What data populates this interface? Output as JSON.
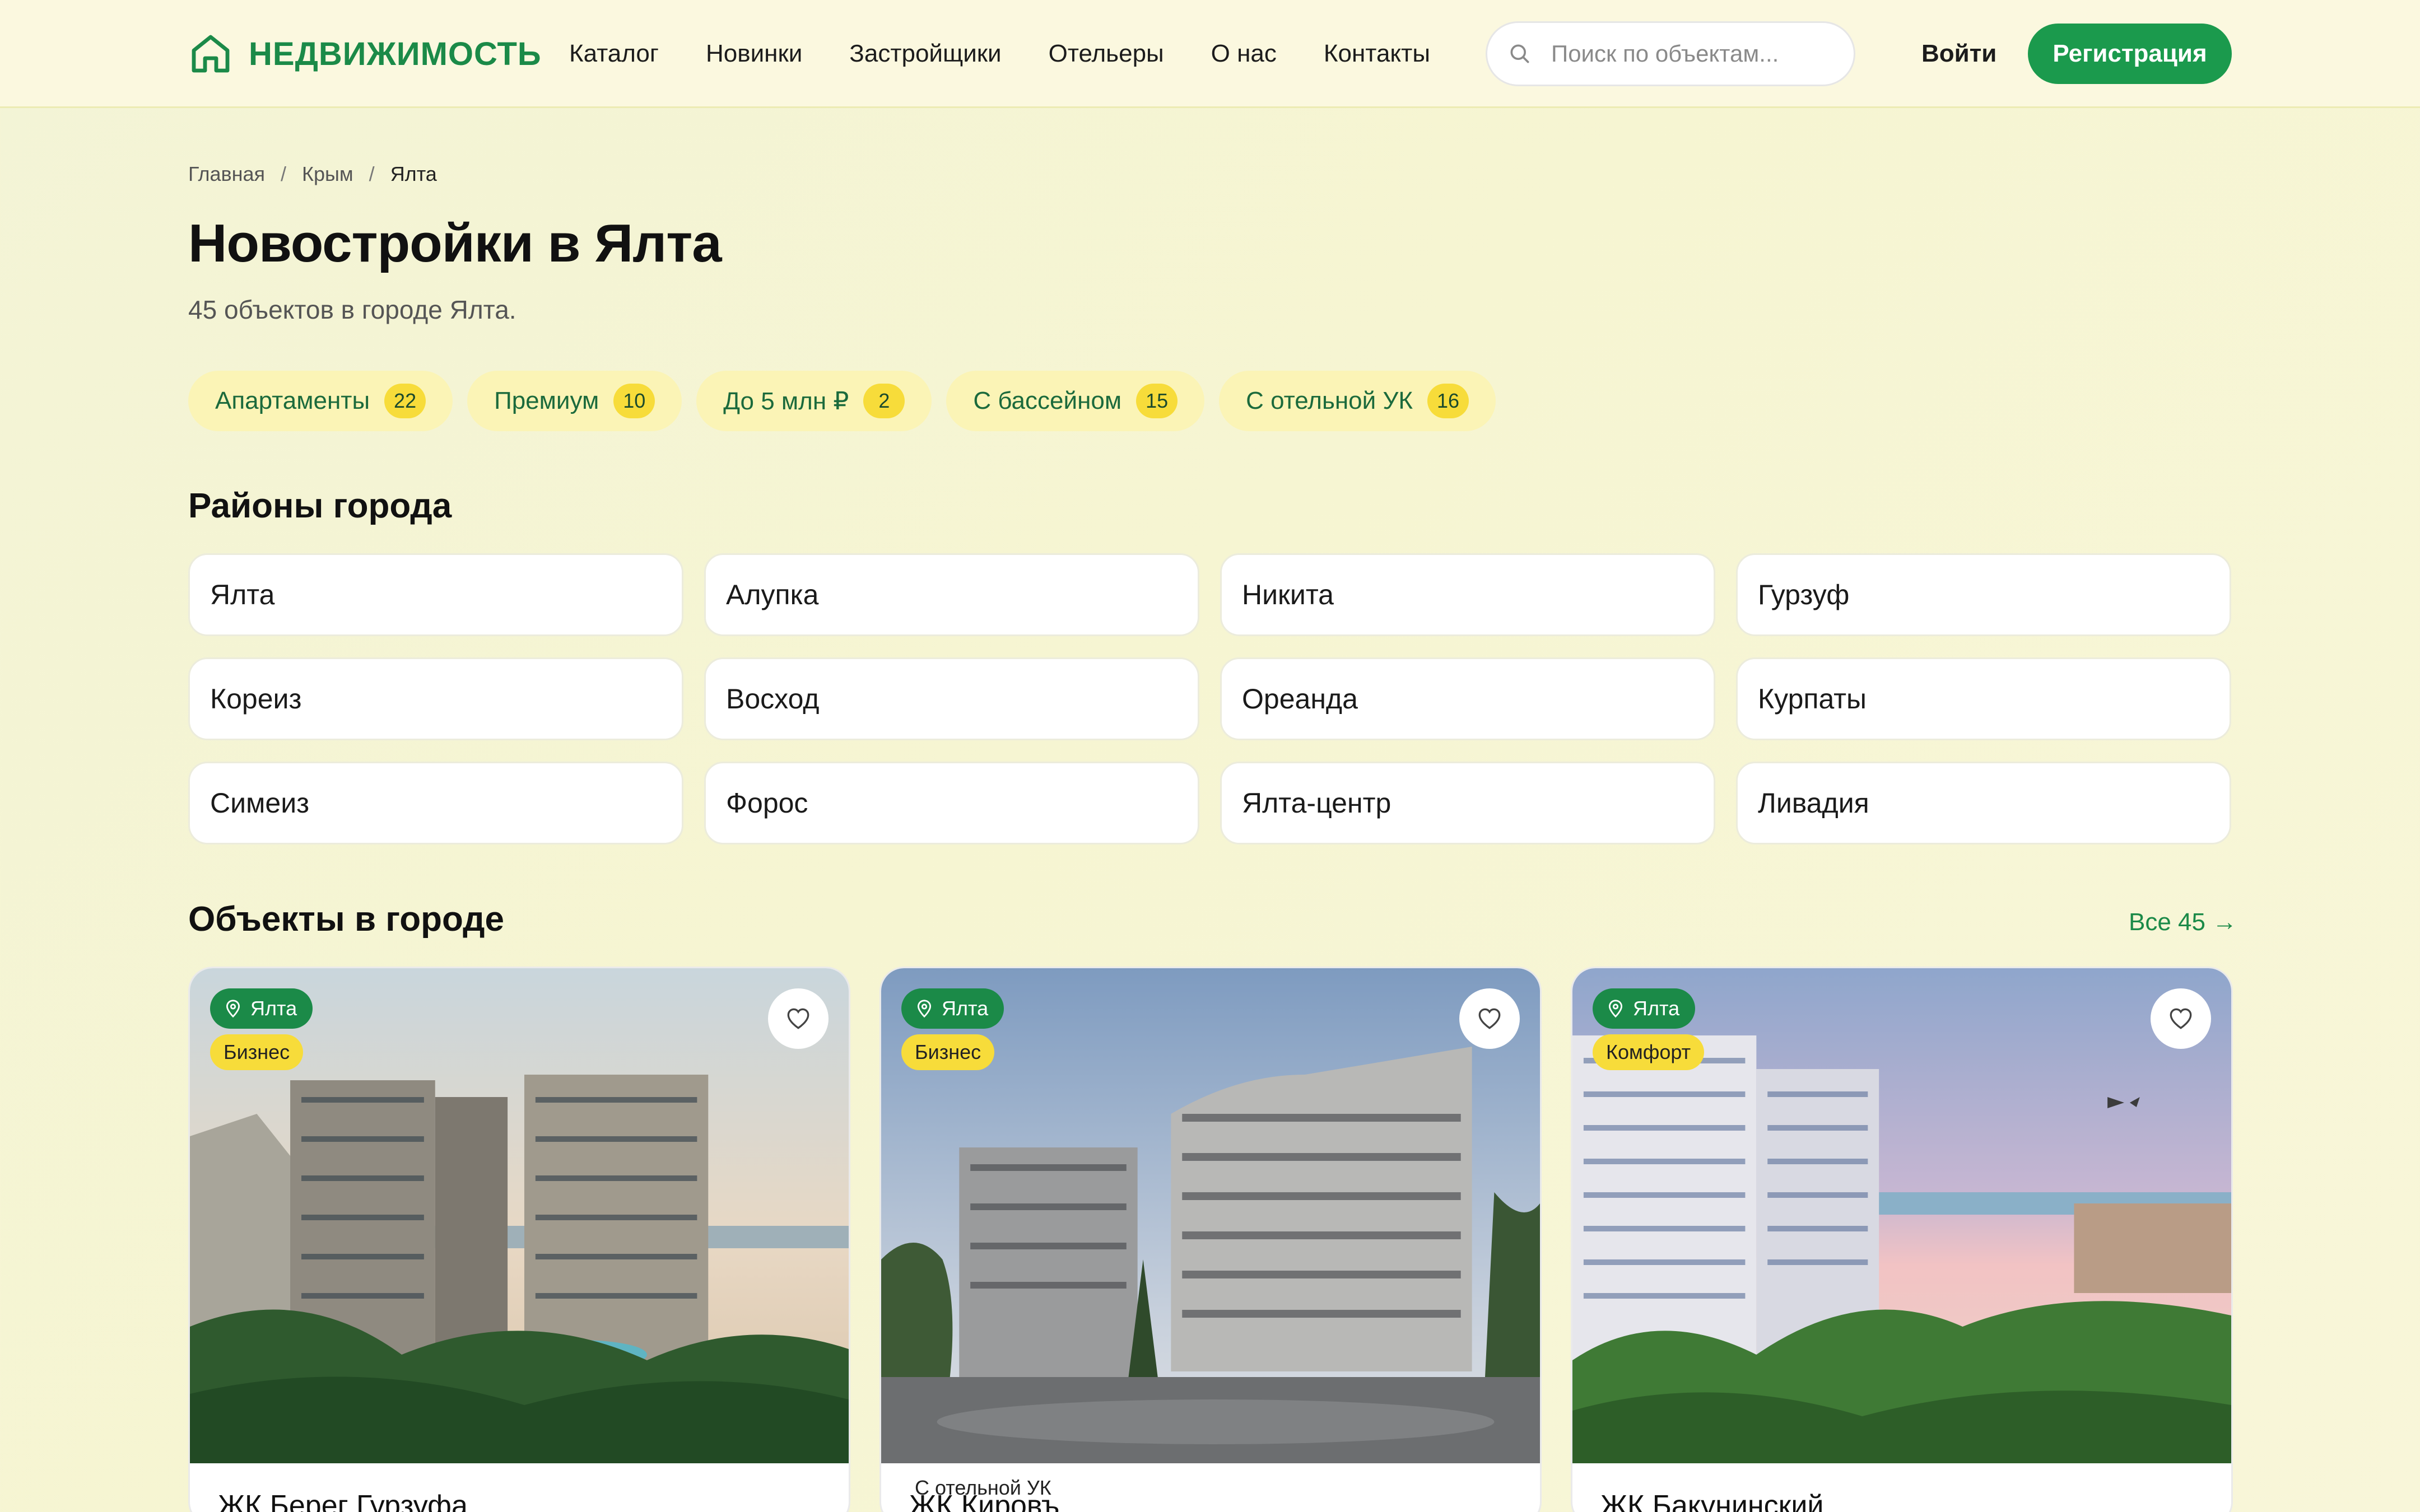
{
  "header": {
    "logo_text": "НЕДВИЖИМОСТЬ",
    "nav": [
      "Каталог",
      "Новинки",
      "Застройщики",
      "Отельеры",
      "О нас",
      "Контакты"
    ],
    "search_placeholder": "Поиск по объектам...",
    "login_label": "Войти",
    "register_label": "Регистрация"
  },
  "breadcrumb": [
    "Главная",
    "Крым",
    "Ялта"
  ],
  "page": {
    "title": "Новостройки в Ялта",
    "subtitle": "45 объектов в городе Ялта."
  },
  "filters": [
    {
      "label": "Апартаменты",
      "count": "22"
    },
    {
      "label": "Премиум",
      "count": "10"
    },
    {
      "label": "До 5 млн ₽",
      "count": "2"
    },
    {
      "label": "С бассейном",
      "count": "15"
    },
    {
      "label": "С отельной УК",
      "count": "16"
    }
  ],
  "districts": {
    "title": "Районы города",
    "items": [
      "Ялта",
      "Алупка",
      "Никита",
      "Гурзуф",
      "Кореиз",
      "Восход",
      "Ореанда",
      "Курпаты",
      "Симеиз",
      "Форос",
      "Ялта-центр",
      "Ливадия"
    ]
  },
  "objects": {
    "title": "Объекты в городе",
    "all_link": "Все 45 →",
    "cards": [
      {
        "city": "Ялта",
        "class": "Бизнес",
        "hotel_tag": "",
        "name": "ЖК Берег Гурзуфа",
        "scene": "sunset"
      },
      {
        "city": "Ялта",
        "class": "Бизнес",
        "hotel_tag": "С отельной УК",
        "name": "ЖК Кировъ",
        "scene": "grey"
      },
      {
        "city": "Ялта",
        "class": "Комфорт",
        "hotel_tag": "",
        "name": "ЖК Бакунинский",
        "scene": "sea"
      }
    ]
  },
  "colors": {
    "brand_green": "#1b9a4d",
    "badge_yellow": "#f7dc3a",
    "chip_bg": "#fbf4b6"
  },
  "icons": [
    "home-logo-icon",
    "search-icon",
    "location-pin-icon",
    "heart-icon"
  ]
}
